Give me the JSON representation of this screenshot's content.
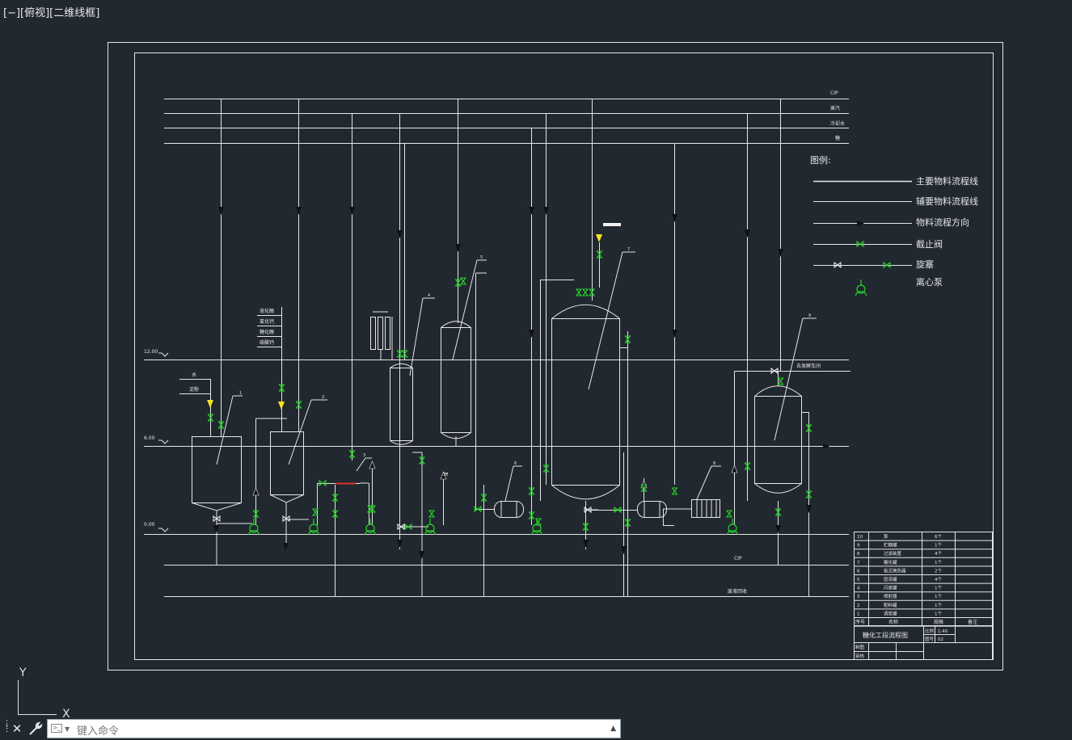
{
  "viewport": {
    "label": "[−][俯视][二维线框]"
  },
  "drawing": {
    "utility_lines": [
      "CIP",
      "蒸汽",
      "冷却水",
      "糖"
    ],
    "legend": {
      "title": "图例:",
      "items": [
        "主要物料流程线",
        "辅要物料流程线",
        "物料流程方向",
        "截止阀",
        "旋塞",
        "离心泵"
      ]
    },
    "elevations": [
      "12.00",
      "6.00",
      "0.00"
    ],
    "feed_labels": [
      "水",
      "淀粉"
    ],
    "additive_labels": [
      "液化酶",
      "氯化钙",
      "糖化酶",
      "硫酸钙"
    ],
    "tag_labels": [
      "1",
      "2",
      "3",
      "4",
      "5",
      "6",
      "7",
      "8",
      "9",
      "10"
    ],
    "outlet_labels": [
      "去发酵车间",
      "CIP",
      "废液回收"
    ],
    "title_block": {
      "rows": [
        [
          "10",
          "泵",
          "6个"
        ],
        [
          "9",
          "贮糖罐",
          "1个"
        ],
        [
          "8",
          "过滤装置",
          "4个"
        ],
        [
          "7",
          "糖化罐",
          "1个"
        ],
        [
          "6",
          "板式换热器",
          "2个"
        ],
        [
          "5",
          "层流罐",
          "4个"
        ],
        [
          "4",
          "闪蒸罐",
          "1个"
        ],
        [
          "3",
          "喷射器",
          "1个"
        ],
        [
          "2",
          "配料罐",
          "1个"
        ],
        [
          "1",
          "调浆罐",
          "1个"
        ]
      ],
      "header": [
        "序号",
        "名称",
        "规格",
        "备注"
      ],
      "drawing_title": "糖化工段流程图",
      "scale_label": "比例",
      "scale_value": "1:40",
      "sheet_label": "图号",
      "sheet_value": "02",
      "drawn_by": "制图",
      "checked_by": "审核"
    }
  },
  "ucs": {
    "x": "X",
    "y": "Y"
  },
  "command_line": {
    "placeholder": "键入命令"
  },
  "colors": {
    "background": "#212830",
    "line": "#e6e6e6",
    "valve": "#27d427",
    "flow_marker": "#f2e61c",
    "injector": "#e03030"
  }
}
